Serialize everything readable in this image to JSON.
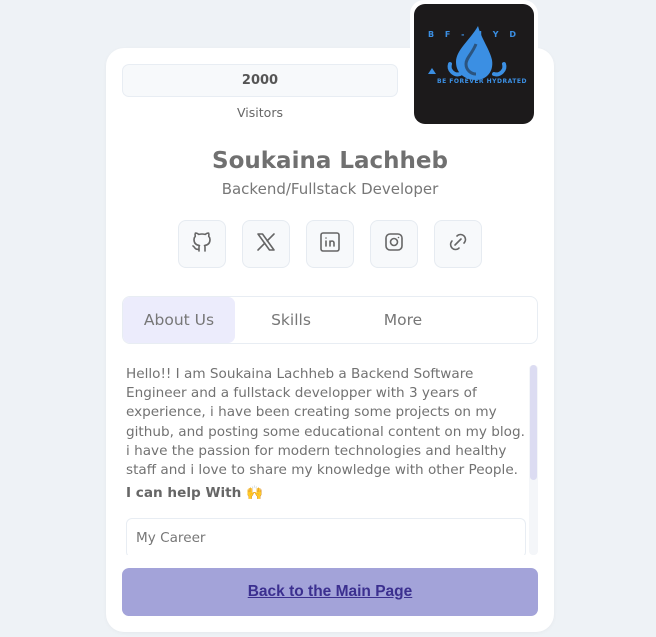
{
  "stats": {
    "visitors_count": "2000",
    "visitors_label": "Visitors"
  },
  "avatar": {
    "logo_text": "BE FOREVER HYDRATED",
    "logo_arc": "B F - H Y D",
    "bg_color": "#1c1a1b",
    "accent_color": "#3b8fe3"
  },
  "profile": {
    "name": "Soukaina Lachheb",
    "role": "Backend/Fullstack Developer"
  },
  "socials": [
    {
      "icon": "github-icon"
    },
    {
      "icon": "x-icon"
    },
    {
      "icon": "linkedin-icon"
    },
    {
      "icon": "instagram-icon"
    },
    {
      "icon": "link-icon"
    }
  ],
  "tabs": [
    {
      "label": "About Us",
      "active": true
    },
    {
      "label": "Skills",
      "active": false
    },
    {
      "label": "More",
      "active": false
    }
  ],
  "about": {
    "text": "Hello!! I am Soukaina Lachheb a Backend Software Engineer and a fullstack developper with 3 years of experience, i have been creating some projects on my github, and posting some educational content on my blog. i have the passion for modern technologies and healthy staff and i love to share my knowledge with other People.",
    "help_title": "I can help With 🙌",
    "career_label": "My Career"
  },
  "footer": {
    "back_label": "Back to the Main Page"
  },
  "colors": {
    "button_bg": "#a3a3d9",
    "button_text": "#3b2f8f",
    "active_tab_bg": "#ececfc"
  }
}
